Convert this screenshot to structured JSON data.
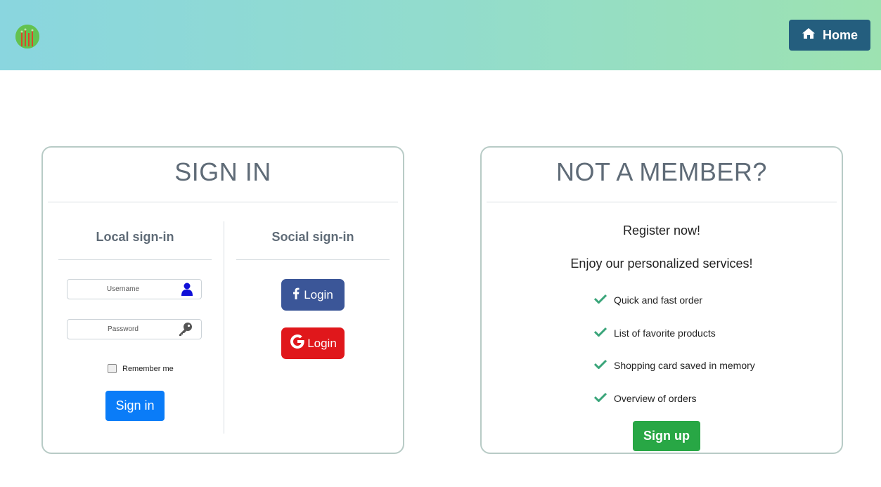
{
  "header": {
    "logo_icon": "plant-logo",
    "home_label": "Home",
    "home_icon": "home-icon"
  },
  "signin": {
    "title": "SIGN IN",
    "local_title": "Local sign-in",
    "social_title": "Social sign-in",
    "username_placeholder": "Username",
    "password_placeholder": "Password",
    "remember_label": "Remember me",
    "signin_label": "Sign in",
    "facebook_label": "Login",
    "google_label": "Login"
  },
  "register": {
    "title": "NOT A MEMBER?",
    "line1": "Register now!",
    "line2": "Enjoy our personalized services!",
    "features": [
      "Quick and fast order",
      "List of favorite products",
      "Shopping card saved in memory",
      "Overview of orders"
    ],
    "signup_label": "Sign up"
  },
  "colors": {
    "header_gradient_start": "#8ad6df",
    "header_gradient_end": "#9de2b1",
    "home_button": "#245e7e",
    "signin_button": "#0a7cf8",
    "facebook": "#3b5698",
    "google": "#e0171b",
    "signup_button": "#28a745",
    "check": "#3aa57a"
  }
}
